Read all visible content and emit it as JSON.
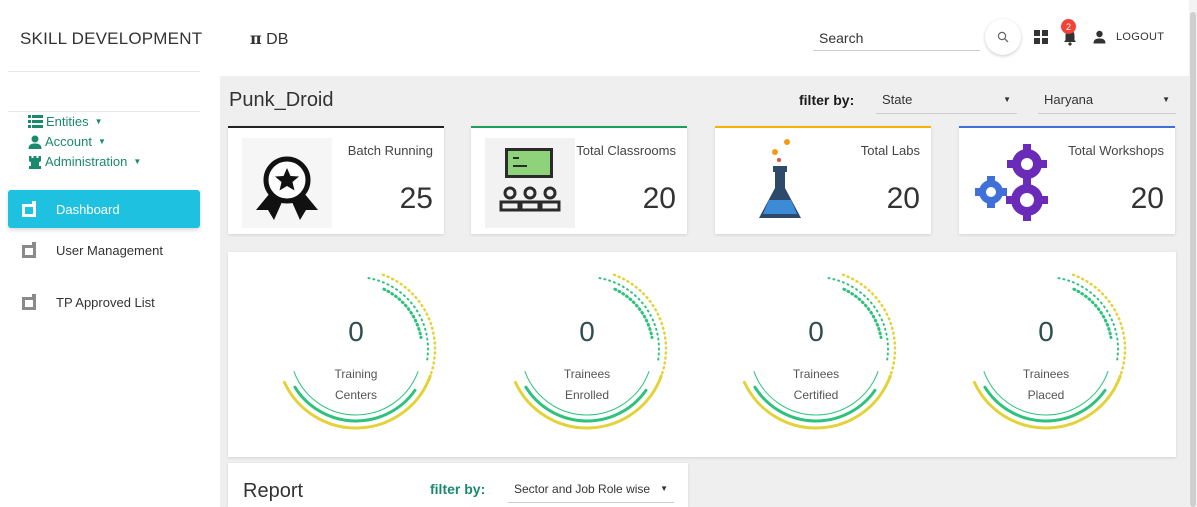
{
  "app": {
    "brand": "SKILL DEVELOPMENT",
    "db_title_symbol": "π",
    "db_title_text": "DB"
  },
  "header": {
    "search_placeholder": "Search",
    "notification_count": "2",
    "logout_label": "LOGOUT"
  },
  "sidebar": {
    "menus": [
      {
        "label": "Entities",
        "icon": "list-icon"
      },
      {
        "label": "Account",
        "icon": "person-icon"
      },
      {
        "label": "Administration",
        "icon": "chess-rook-icon"
      }
    ],
    "nav": [
      {
        "label": "Dashboard",
        "active": true
      },
      {
        "label": "User Management",
        "active": false
      },
      {
        "label": "TP Approved List",
        "active": false
      }
    ]
  },
  "main": {
    "page_title": "Punk_Droid",
    "filter_label": "filter by:",
    "filter_type": "State",
    "filter_value": "Haryana"
  },
  "cards": [
    {
      "label": "Batch Running",
      "value": "25",
      "color": "#222222",
      "icon": "award-ribbon-icon"
    },
    {
      "label": "Total Classrooms",
      "value": "20",
      "color": "#1e9e5a",
      "icon": "classroom-icon"
    },
    {
      "label": "Total Labs",
      "value": "20",
      "color": "#f5b400",
      "icon": "flask-icon"
    },
    {
      "label": "Total Workshops",
      "value": "20",
      "color": "#3f6fd8",
      "icon": "gears-icon"
    }
  ],
  "gauges": [
    {
      "value": "0",
      "line1": "Training",
      "line2": "Centers"
    },
    {
      "value": "0",
      "line1": "Trainees",
      "line2": "Enrolled"
    },
    {
      "value": "0",
      "line1": "Trainees",
      "line2": "Certified"
    },
    {
      "value": "0",
      "line1": "Trainees",
      "line2": "Placed"
    }
  ],
  "report": {
    "title": "Report",
    "filter_label": "filter by:",
    "filter_value": "Sector and Job Role wise"
  }
}
